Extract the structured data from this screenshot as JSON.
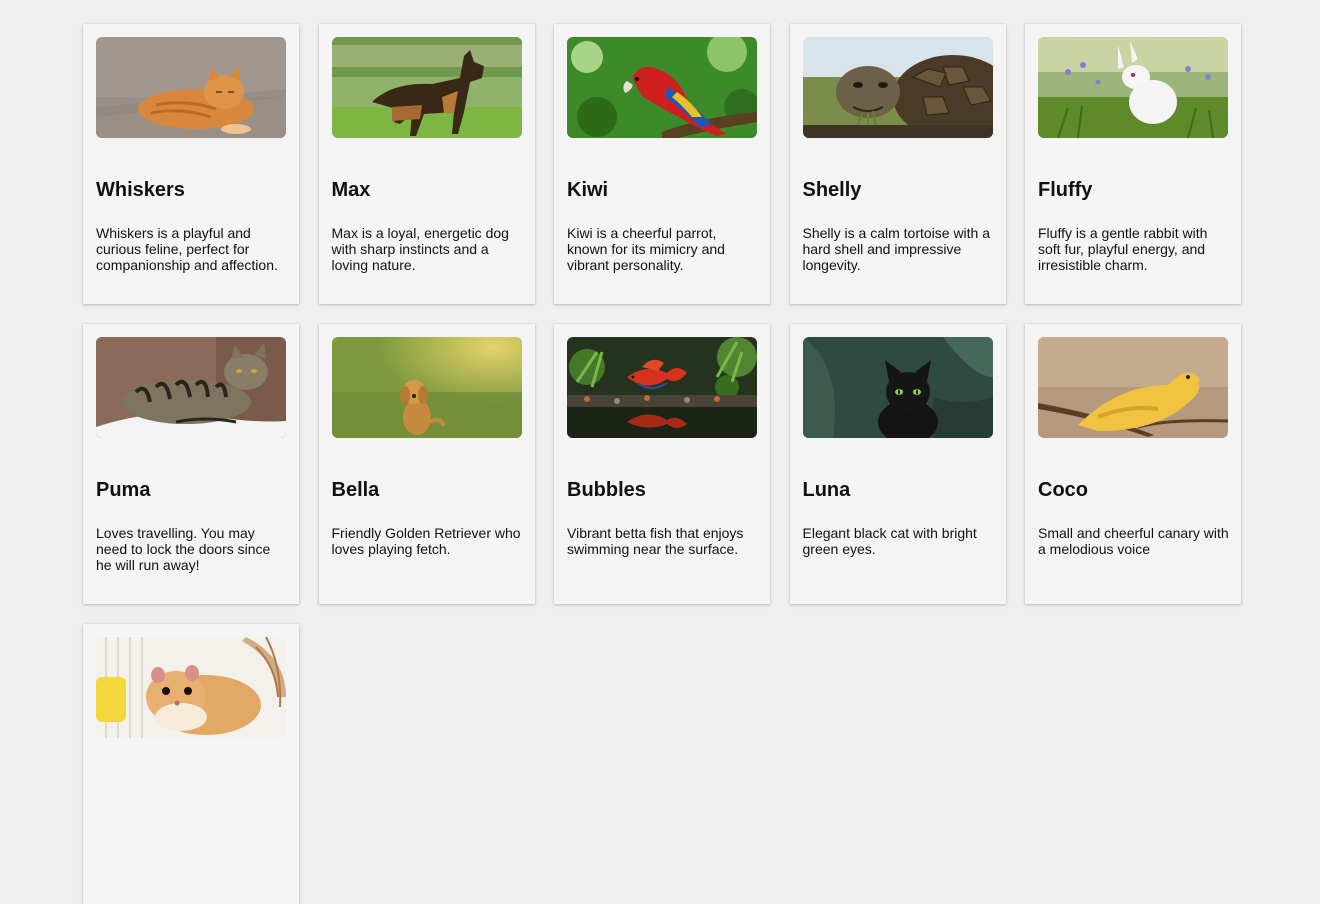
{
  "pets": [
    {
      "name": "Whiskers",
      "description": "Whiskers is a playful and curious feline, perfect for companionship and affection.",
      "image": "orange-tabby-cat-photo"
    },
    {
      "name": "Max",
      "description": "Max is a loyal, energetic dog with sharp instincts and a loving nature.",
      "image": "german-shepherd-dog-photo"
    },
    {
      "name": "Kiwi",
      "description": "Kiwi is a cheerful parrot, known for its mimicry and vibrant personality.",
      "image": "scarlet-macaw-parrot-photo"
    },
    {
      "name": "Shelly",
      "description": "Shelly is a calm tortoise with a hard shell and impressive longevity.",
      "image": "giant-tortoise-photo"
    },
    {
      "name": "Fluffy",
      "description": "Fluffy is a gentle rabbit with soft fur, playful energy, and irresistible charm.",
      "image": "white-rabbit-photo"
    },
    {
      "name": "Puma",
      "description": "Loves travelling. You may need to lock the doors since he will run away!",
      "image": "striped-tabby-cat-photo"
    },
    {
      "name": "Bella",
      "description": "Friendly Golden Retriever who loves playing fetch.",
      "image": "golden-retriever-puppy-photo"
    },
    {
      "name": "Bubbles",
      "description": "Vibrant betta fish that enjoys swimming near the surface.",
      "image": "red-betta-fish-photo"
    },
    {
      "name": "Luna",
      "description": "Elegant black cat with bright green eyes.",
      "image": "black-cat-photo"
    },
    {
      "name": "Coco",
      "description": "Small and cheerful canary with a melodious voice",
      "image": "yellow-canary-photo"
    },
    {
      "name": "",
      "description": "",
      "image": "hamster-photo"
    }
  ]
}
